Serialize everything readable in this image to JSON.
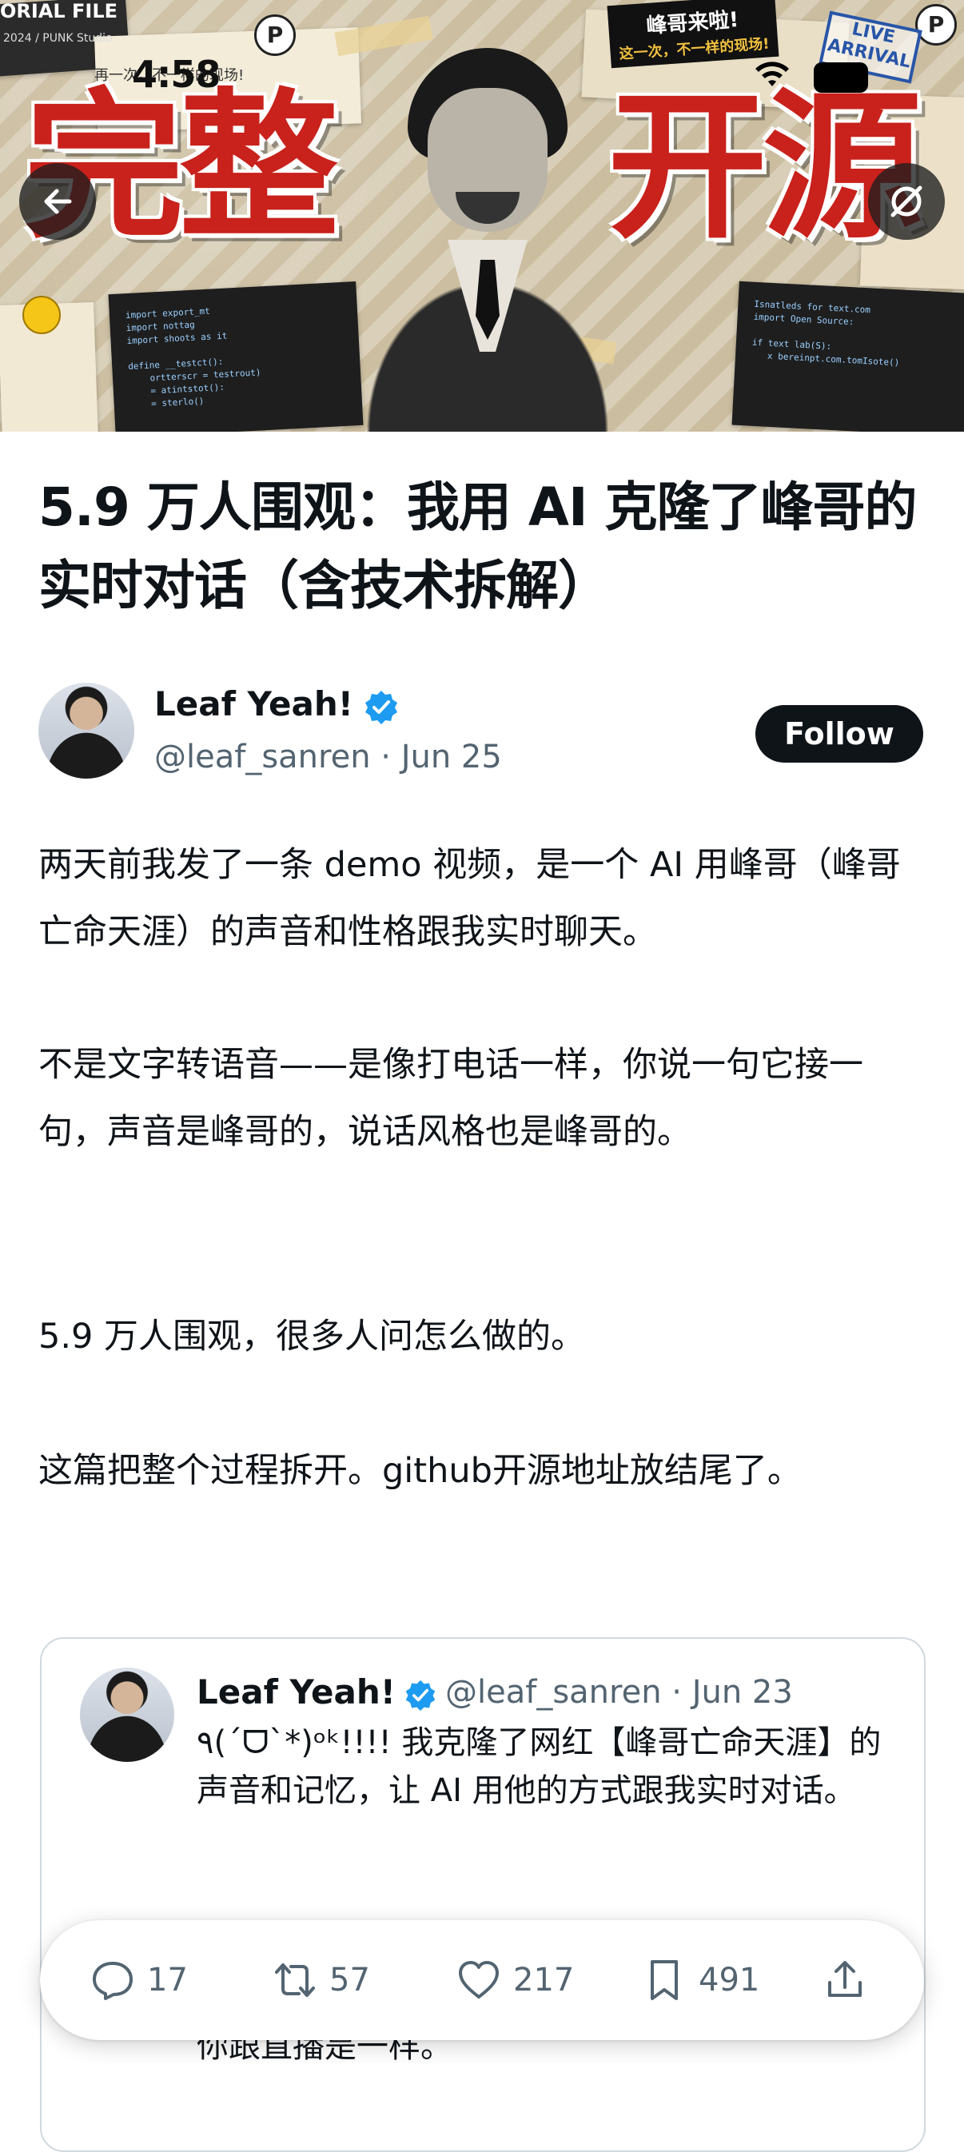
{
  "status_bar": {
    "time": "4:58"
  },
  "hero": {
    "title_left": "完整",
    "title_right": "开源",
    "corner_text": "ORIAL FILE",
    "corner_sub": "2024 / PUNK Studio",
    "caption": "再一次，不一样的现场!",
    "sticker_main": "峰哥来啦!",
    "sticker_sub": "这一次，不一样的现场!",
    "live_stamp_line1": "LIVE",
    "live_stamp_line2": "ARRIVAL",
    "badge_letter": "P"
  },
  "article": {
    "title": "5.9 万人围观：我用 AI 克隆了峰哥的实时对话（含技术拆解）",
    "author_name": "Leaf Yeah!",
    "author_meta": "@leaf_sanren · Jun 25",
    "follow_label": "Follow",
    "paragraphs": [
      "两天前我发了一条 demo 视频，是一个 AI 用峰哥（峰哥亡命天涯）的声音和性格跟我实时聊天。",
      "不是文字转语音——是像打电话一样，你说一句它接一句，声音是峰哥的，说话风格也是峰哥的。",
      "5.9 万人围观，很多人问怎么做的。",
      "这篇把整个过程拆开。github开源地址放结尾了。"
    ]
  },
  "quote": {
    "author_name": "Leaf Yeah!",
    "meta": "@leaf_sanren · Jun 23",
    "text": "٩(ˊᗜˋ*)ᵒᵏ!!!! 我克隆了网红【峰哥亡命天涯】的声音和记忆，让 AI 用他的方式跟我实时对话。",
    "partial_line": "你跟直播是一样。"
  },
  "actions": {
    "replies": "17",
    "reposts": "57",
    "likes": "217",
    "bookmarks": "491"
  },
  "colors": {
    "accent_red": "#c9211b",
    "verified_blue": "#1d9bf0",
    "text_primary": "#0f1419",
    "text_secondary": "#536471"
  }
}
